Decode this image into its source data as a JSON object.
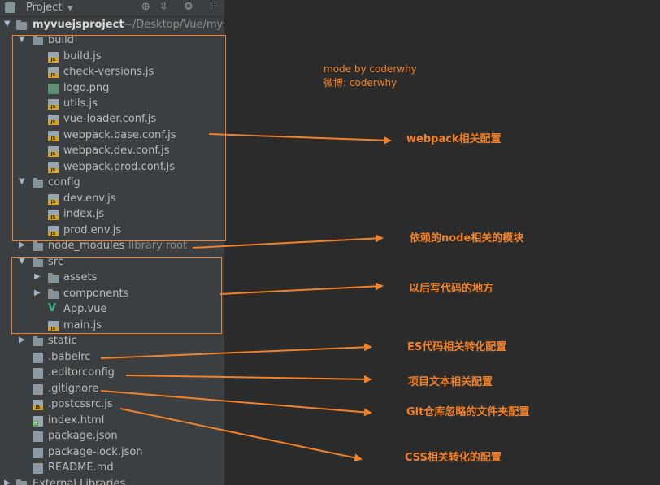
{
  "toolbar": {
    "title": "Project",
    "dropdown_icon": "▾",
    "locate_icon": "⊕",
    "collapse_icon": "⇳",
    "settings_icon": "⚙",
    "hide_icon": "⊢"
  },
  "tree": {
    "root_name": "myvuejsproject",
    "root_path": "~/Desktop/Vue/myv",
    "build": {
      "label": "build",
      "files": [
        "build.js",
        "check-versions.js",
        "logo.png",
        "utils.js",
        "vue-loader.conf.js",
        "webpack.base.conf.js",
        "webpack.dev.conf.js",
        "webpack.prod.conf.js"
      ]
    },
    "config": {
      "label": "config",
      "files": [
        "dev.env.js",
        "index.js",
        "prod.env.js"
      ]
    },
    "node_modules": {
      "label": "node_modules",
      "tag": "library root"
    },
    "src": {
      "label": "src",
      "assets": "assets",
      "components": "components",
      "app": "App.vue",
      "main": "main.js"
    },
    "static": "static",
    "root_files": [
      ".babelrc",
      ".editorconfig",
      ".gitignore",
      ".postcssrc.js",
      "index.html",
      "package.json",
      "package-lock.json",
      "README.md"
    ],
    "external": "External Libraries"
  },
  "credit": {
    "line1": "mode by coderwhy",
    "line2": "微博: coderwhy"
  },
  "annotations": {
    "webpack": "webpack相关配置",
    "node": "依赖的node相关的模块",
    "src": "以后写代码的地方",
    "es": "ES代码相关转化配置",
    "editor": "项目文本相关配置",
    "git": "Git仓库忽略的文件夹配置",
    "css": "CSS相关转化的配置"
  },
  "colors": {
    "accent": "#f2812c",
    "panel": "#3c3f41",
    "background": "#2b2b2b",
    "text": "#bbbbbb"
  }
}
